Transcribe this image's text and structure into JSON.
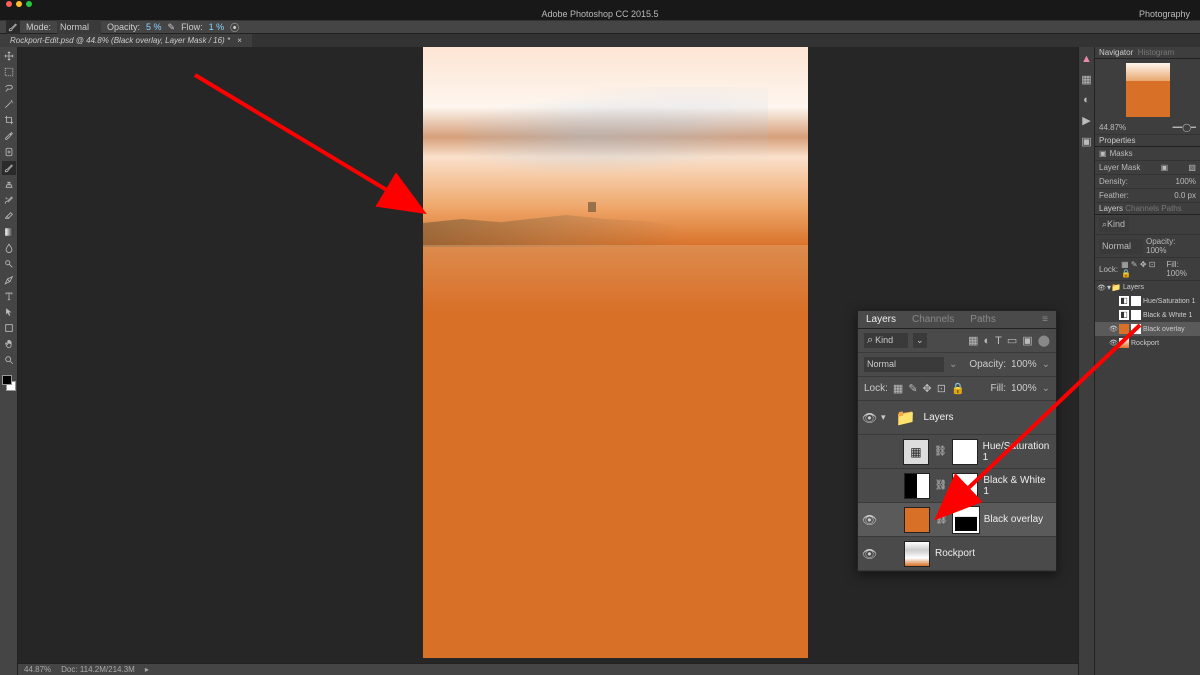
{
  "app": {
    "title": "Adobe Photoshop CC 2015.5",
    "workspace": "Photography"
  },
  "options": {
    "mode_lbl": "Mode:",
    "mode": "Normal",
    "opacity_lbl": "Opacity:",
    "opacity": "5 %",
    "flow_lbl": "Flow:",
    "flow": "1 %"
  },
  "doc_tab": "Rockport-Edit.psd @ 44.8% (Black overlay, Layer Mask / 16) *",
  "status": {
    "zoom": "44.87%",
    "info": "Doc: 114.2M/214.3M"
  },
  "mac": {
    "close": "#ff5f57",
    "min": "#ffbd2e",
    "max": "#28c940"
  },
  "rpanels": {
    "nav": "Navigator",
    "hist": "Histogram",
    "props": "Properties",
    "masks": "Masks",
    "layermask": "Layer Mask",
    "density_lbl": "Density:",
    "density": "100%",
    "feather_lbl": "Feather:",
    "feather": "0.0 px",
    "layers_tab": "Layers",
    "channels_tab": "Channels",
    "paths_tab": "Paths",
    "blend": "Normal",
    "opacity_lbl": "Opacity:",
    "opacity": "100%",
    "fill_lbl": "Fill:",
    "fill": "100%",
    "nav_zoom": "44.87%"
  },
  "layers_float": {
    "tabs": {
      "layers": "Layers",
      "channels": "Channels",
      "paths": "Paths"
    },
    "filter": "Kind",
    "blend": "Normal",
    "opacity_lbl": "Opacity:",
    "opacity": "100%",
    "lock_lbl": "Lock:",
    "fill_lbl": "Fill:",
    "fill": "100%",
    "group": "Layers",
    "layers": [
      {
        "name": "Hue/Saturation 1"
      },
      {
        "name": "Black & White 1"
      },
      {
        "name": "Black overlay"
      },
      {
        "name": "Rockport"
      }
    ]
  },
  "mini_layers": [
    {
      "name": "Layers",
      "folder": true
    },
    {
      "name": "Hue/Saturation 1"
    },
    {
      "name": "Black & White 1"
    },
    {
      "name": "Black overlay",
      "selected": true
    },
    {
      "name": "Rockport"
    }
  ]
}
